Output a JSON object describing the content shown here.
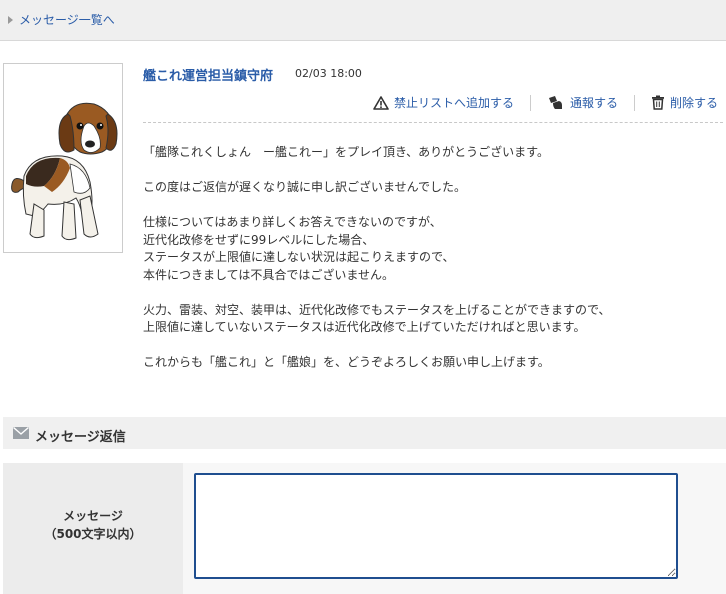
{
  "nav": {
    "back_label": "メッセージ一覧へ"
  },
  "message": {
    "sender": "艦これ運営担当鎮守府",
    "date": "02/03 18:00",
    "actions": {
      "block_label": "禁止リストへ追加する",
      "report_label": "通報する",
      "delete_label": "削除する"
    },
    "paragraphs": [
      [
        "「艦隊これくしょん　ー艦これー」をプレイ頂き、ありがとうございます。"
      ],
      [
        "この度はご返信が遅くなり誠に申し訳ございませんでした。"
      ],
      [
        "仕様についてはあまり詳しくお答えできないのですが、",
        "近代化改修をせずに99レベルにした場合、",
        "ステータスが上限値に達しない状況は起こりえますので、",
        "本件につきましては不具合ではございません。"
      ],
      [
        "火力、雷装、対空、装甲は、近代化改修でもステータスを上げることができますので、",
        "上限値に達していないステータスは近代化改修で上げていただければと思います。"
      ],
      [
        "これからも「艦これ」と「艦娘」を、どうぞよろしくお願い申し上げます。"
      ]
    ]
  },
  "reply": {
    "title": "メッセージ返信",
    "label_line1": "メッセージ",
    "label_line2": "（500文字以内）",
    "textarea_value": ""
  }
}
